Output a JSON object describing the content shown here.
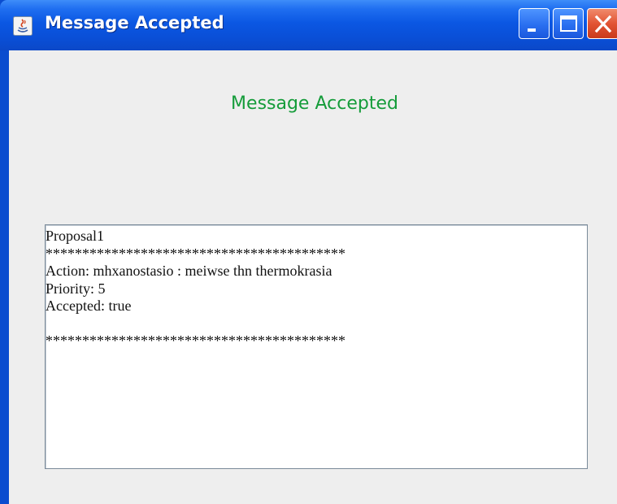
{
  "window": {
    "title": "Message Accepted",
    "icon": "java-app-icon",
    "controls": [
      "minimize-icon",
      "maximize-icon",
      "close-icon"
    ]
  },
  "heading": {
    "text": "Message Accepted",
    "color": "#159c3a"
  },
  "message_area": {
    "lines": [
      "Proposal1",
      "*****************************************",
      "Action: mhxanostasio : meiwse thn thermokrasia",
      "Priority: 5",
      "Accepted: true",
      "",
      "*****************************************"
    ]
  },
  "colors": {
    "titlebar": "#0b57e3",
    "client_background": "#eeeeee",
    "close_button": "#e25434"
  }
}
